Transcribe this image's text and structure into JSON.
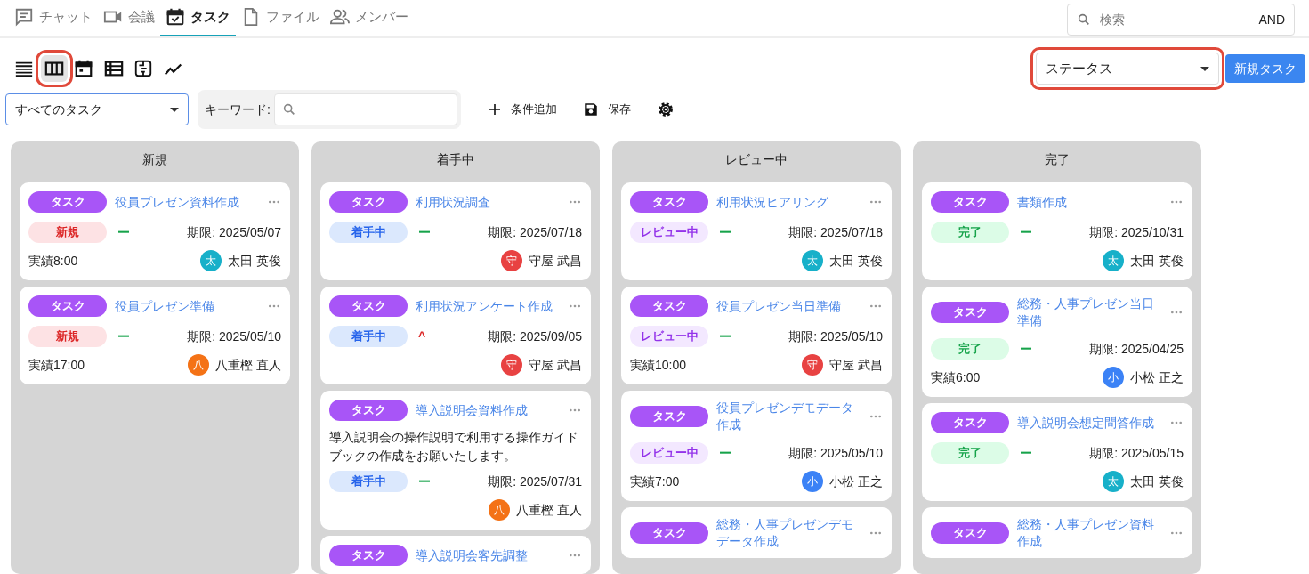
{
  "tabs": [
    {
      "label": "チャット",
      "selected": false
    },
    {
      "label": "会議",
      "selected": false
    },
    {
      "label": "タスク",
      "selected": true
    },
    {
      "label": "ファイル",
      "selected": false
    },
    {
      "label": "メンバー",
      "selected": false
    }
  ],
  "search": {
    "placeholder": "検索",
    "mode": "AND"
  },
  "toolbar": {
    "view_buttons": [
      {
        "selected": false,
        "highlighted": false
      },
      {
        "selected": true,
        "highlighted": true
      },
      {
        "selected": false,
        "highlighted": false
      },
      {
        "selected": false,
        "highlighted": false
      },
      {
        "selected": false,
        "highlighted": false
      },
      {
        "selected": false,
        "highlighted": false
      }
    ],
    "group_select": {
      "value": "ステータス",
      "highlighted": true
    },
    "new_button": "新規タスク"
  },
  "filters": {
    "view_select": "すべてのタスク",
    "keyword_label": "キーワード:",
    "add_condition": "条件追加",
    "save": "保存"
  },
  "columns": [
    {
      "title": "新規",
      "cards": [
        {
          "type": "タスク",
          "title": "役員プレゼン資料作成",
          "status": {
            "label": "新規",
            "kind": "new"
          },
          "priority": {
            "mark": "ー",
            "kind": "normal"
          },
          "due": "期限: 2025/05/07",
          "actual": "実績8:00",
          "avatar": "太",
          "color": "#17b0c9",
          "assignee": "太田 英俊"
        },
        {
          "type": "タスク",
          "title": "役員プレゼン準備",
          "status": {
            "label": "新規",
            "kind": "new"
          },
          "priority": {
            "mark": "ー",
            "kind": "normal"
          },
          "due": "期限: 2025/05/10",
          "actual": "実績17:00",
          "avatar": "八",
          "color": "#f47216",
          "assignee": "八重樫 直人"
        }
      ]
    },
    {
      "title": "着手中",
      "cards": [
        {
          "type": "タスク",
          "title": "利用状況調査",
          "status": {
            "label": "着手中",
            "kind": "in_progress"
          },
          "priority": {
            "mark": "ー",
            "kind": "normal"
          },
          "due": "期限: 2025/07/18",
          "avatar": "守",
          "color": "#e84242",
          "assignee": "守屋 武昌"
        },
        {
          "type": "タスク",
          "title": "利用状況アンケート作成",
          "status": {
            "label": "着手中",
            "kind": "in_progress"
          },
          "priority": {
            "mark": "^",
            "kind": "high"
          },
          "due": "期限: 2025/09/05",
          "avatar": "守",
          "color": "#e84242",
          "assignee": "守屋 武昌"
        },
        {
          "type": "タスク",
          "title": "導入説明会資料作成",
          "description": "導入説明会の操作説明で利用する操作ガイドブックの作成をお願いたします。",
          "status": {
            "label": "着手中",
            "kind": "in_progress"
          },
          "priority": {
            "mark": "ー",
            "kind": "normal"
          },
          "due": "期限: 2025/07/31",
          "avatar": "八",
          "color": "#f47216",
          "assignee": "八重樫 直人"
        },
        {
          "type": "タスク",
          "title": "導入説明会客先調整"
        }
      ]
    },
    {
      "title": "レビュー中",
      "cards": [
        {
          "type": "タスク",
          "title": "利用状況ヒアリング",
          "status": {
            "label": "レビュー中",
            "kind": "review"
          },
          "priority": {
            "mark": "ー",
            "kind": "normal"
          },
          "due": "期限: 2025/07/18",
          "avatar": "太",
          "color": "#17b0c9",
          "assignee": "太田 英俊"
        },
        {
          "type": "タスク",
          "title": "役員プレゼン当日準備",
          "status": {
            "label": "レビュー中",
            "kind": "review"
          },
          "priority": {
            "mark": "ー",
            "kind": "normal"
          },
          "due": "期限: 2025/05/10",
          "actual": "実績10:00",
          "avatar": "守",
          "color": "#e84242",
          "assignee": "守屋 武昌"
        },
        {
          "type": "タスク",
          "title": "役員プレゼンデモデータ作成",
          "status": {
            "label": "レビュー中",
            "kind": "review"
          },
          "priority": {
            "mark": "ー",
            "kind": "normal"
          },
          "due": "期限: 2025/05/10",
          "actual": "実績7:00",
          "avatar": "小",
          "color": "#3b82f6",
          "assignee": "小松 正之"
        },
        {
          "type": "タスク",
          "title": "総務・人事プレゼンデモデータ作成"
        }
      ]
    },
    {
      "title": "完了",
      "cards": [
        {
          "type": "タスク",
          "title": "書類作成",
          "status": {
            "label": "完了",
            "kind": "done"
          },
          "priority": {
            "mark": "ー",
            "kind": "normal"
          },
          "due": "期限: 2025/10/31",
          "avatar": "太",
          "color": "#17b0c9",
          "assignee": "太田 英俊"
        },
        {
          "type": "タスク",
          "title": "総務・人事プレゼン当日準備",
          "status": {
            "label": "完了",
            "kind": "done"
          },
          "priority": {
            "mark": "ー",
            "kind": "normal"
          },
          "due": "期限: 2025/04/25",
          "actual": "実績6:00",
          "avatar": "小",
          "color": "#3b82f6",
          "assignee": "小松 正之"
        },
        {
          "type": "タスク",
          "title": "導入説明会想定問答作成",
          "status": {
            "label": "完了",
            "kind": "done"
          },
          "priority": {
            "mark": "ー",
            "kind": "normal"
          },
          "due": "期限: 2025/05/15",
          "avatar": "太",
          "color": "#17b0c9",
          "assignee": "太田 英俊"
        },
        {
          "type": "タスク",
          "title": "総務・人事プレゼン資料作成"
        }
      ]
    }
  ]
}
